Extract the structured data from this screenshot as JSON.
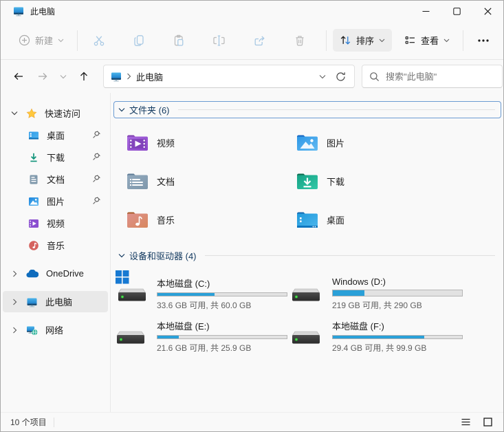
{
  "window": {
    "title": "此电脑"
  },
  "toolbar": {
    "new_label": "新建",
    "sort_label": "排序",
    "view_label": "查看",
    "icons": [
      "plus-circle",
      "cut",
      "copy",
      "paste",
      "rename",
      "share",
      "delete",
      "sort-arrows",
      "view-list",
      "more-ellipsis"
    ]
  },
  "address": {
    "location": "此电脑",
    "search_placeholder": "搜索\"此电脑\""
  },
  "sidebar": {
    "quick_access_label": "快速访问",
    "quick_items": [
      {
        "label": "桌面",
        "pinned": true
      },
      {
        "label": "下载",
        "pinned": true
      },
      {
        "label": "文档",
        "pinned": true
      },
      {
        "label": "图片",
        "pinned": true
      },
      {
        "label": "视频",
        "pinned": false
      },
      {
        "label": "音乐",
        "pinned": false
      }
    ],
    "roots": [
      {
        "label": "OneDrive",
        "selected": false
      },
      {
        "label": "此电脑",
        "selected": true
      },
      {
        "label": "网络",
        "selected": false
      }
    ]
  },
  "main": {
    "folders_section_title": "文件夹 (6)",
    "folders": [
      {
        "label": "视频"
      },
      {
        "label": "图片"
      },
      {
        "label": "文档"
      },
      {
        "label": "下载"
      },
      {
        "label": "音乐"
      },
      {
        "label": "桌面"
      }
    ],
    "drives_section_title": "设备和驱动器 (4)",
    "drives": [
      {
        "name": "本地磁盘 (C:)",
        "detail": "33.6 GB 可用, 共 60.0 GB",
        "used_pct": 44,
        "windows_badge": true
      },
      {
        "name": "Windows (D:)",
        "detail": "219 GB 可用, 共 290 GB",
        "used_pct": 24.5,
        "windows_badge": false
      },
      {
        "name": "本地磁盘 (E:)",
        "detail": "21.6 GB 可用, 共 25.9 GB",
        "used_pct": 16.5,
        "windows_badge": false
      },
      {
        "name": "本地磁盘 (F:)",
        "detail": "29.4 GB 可用, 共 99.9 GB",
        "used_pct": 70.5,
        "windows_badge": false
      }
    ]
  },
  "statusbar": {
    "items_count": "10 个项目"
  },
  "colors": {
    "drive_bar_fill": "#2aa0d8",
    "selection_bg": "#e9e9e9",
    "focus_border": "#6b9bd2",
    "header_text": "#12395f",
    "hover_bg": "#ededed",
    "accent": "#0067c0"
  }
}
